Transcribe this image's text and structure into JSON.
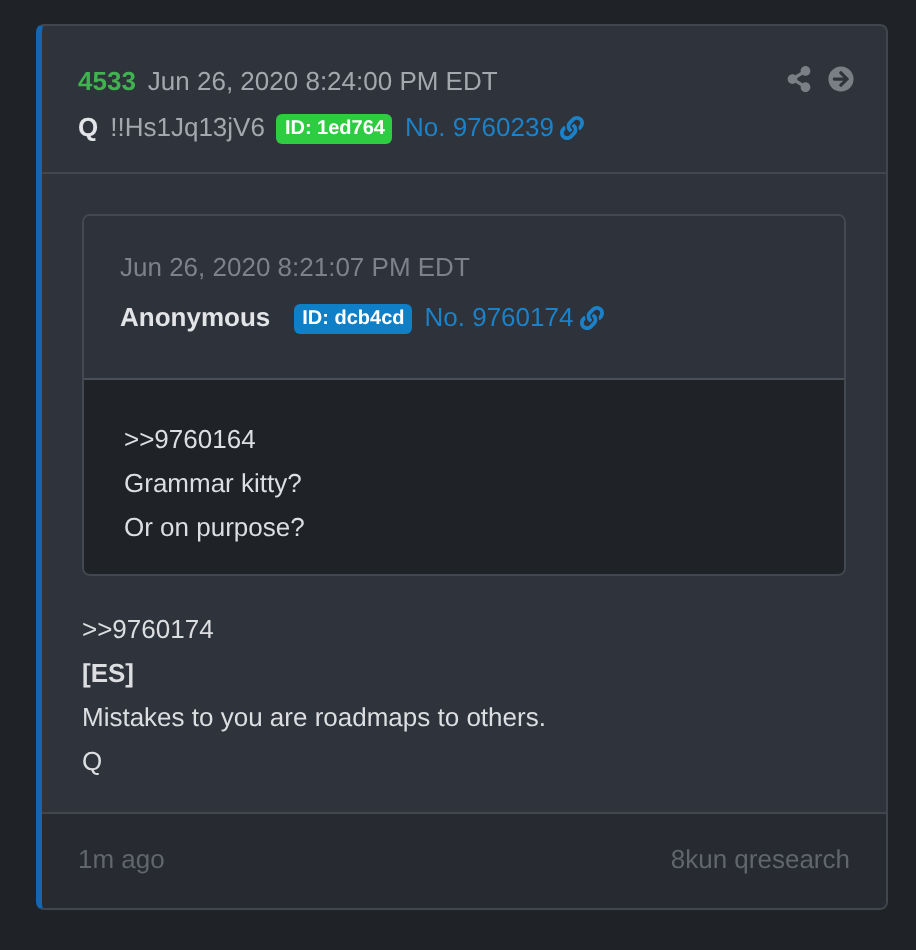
{
  "post": {
    "number": "4533",
    "date": "Jun 26, 2020 8:24:00 PM EDT",
    "author": "Q",
    "tripcode": "!!Hs1Jq13jV6",
    "id_badge": "ID: 1ed764",
    "post_link": "No. 9760239"
  },
  "quote": {
    "date": "Jun 26, 2020 8:21:07 PM EDT",
    "author": "Anonymous",
    "id_badge": "ID: dcb4cd",
    "post_link": "No. 9760174",
    "lines": [
      ">>9760164",
      "Grammar kitty?",
      "Or on purpose?"
    ]
  },
  "body": [
    {
      "text": ">>9760174",
      "bold": false
    },
    {
      "text": "[ES]",
      "bold": true
    },
    {
      "text": "Mistakes to you are roadmaps to others.",
      "bold": false
    },
    {
      "text": "Q",
      "bold": false
    }
  ],
  "footer": {
    "time": "1m ago",
    "source": "8kun qresearch"
  }
}
